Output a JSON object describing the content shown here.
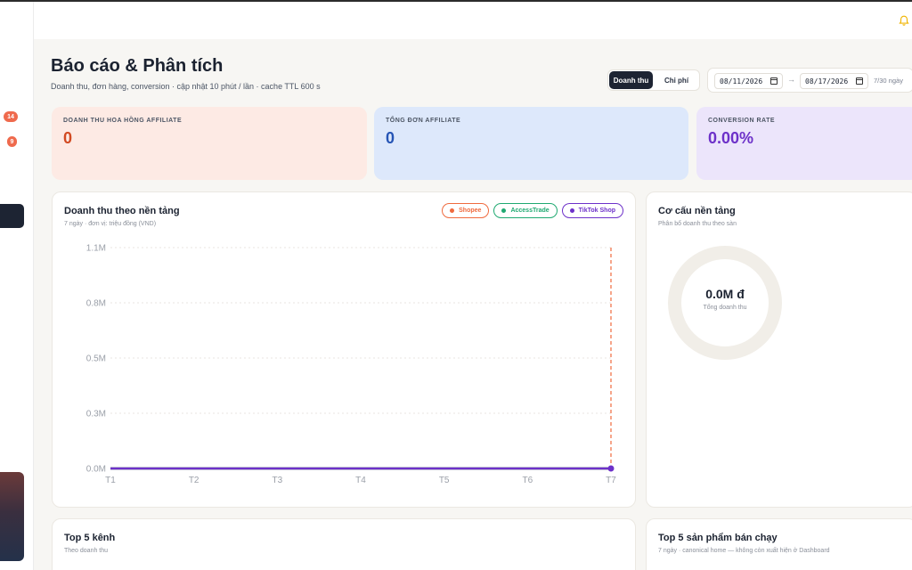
{
  "sidebar": {
    "badges": [
      "14",
      "9"
    ]
  },
  "header": {
    "title": "Báo cáo & Phân tích",
    "subtitle": "Doanh thu, đơn hàng, conversion · cập nhật 10 phút / lần · cache TTL 600 s"
  },
  "toolbar": {
    "tabs": [
      {
        "label": "Doanh thu",
        "active": true
      },
      {
        "label": "Chi phí",
        "active": false
      }
    ],
    "date_from": "08/11/2026",
    "date_sep": "→",
    "date_to": "08/17/2026",
    "range": "7/30 ngày"
  },
  "kpis": [
    {
      "label": "DOANH THU HOA HỒNG AFFILIATE",
      "value": "0"
    },
    {
      "label": "TỔNG ĐƠN AFFILIATE",
      "value": "0"
    },
    {
      "label": "CONVERSION RATE",
      "value": "0.00%"
    }
  ],
  "revenue_card": {
    "title": "Doanh thu theo nền tảng",
    "subtitle": "7 ngày · đơn vị: triệu đồng (VND)",
    "legend": [
      {
        "label": "Shopee",
        "color": "#ef6a3e"
      },
      {
        "label": "AccessTrade",
        "color": "#1fa971"
      },
      {
        "label": "TikTok Shop",
        "color": "#6d31c9"
      }
    ]
  },
  "chart_data": {
    "type": "line",
    "categories": [
      "T1",
      "T2",
      "T3",
      "T4",
      "T5",
      "T6",
      "T7"
    ],
    "y_ticks": [
      "0.0M",
      "0.3M",
      "0.5M",
      "0.8M",
      "1.1M"
    ],
    "ylim": [
      0,
      1.1
    ],
    "grid": true,
    "series": [
      {
        "name": "Shopee",
        "color": "#ef6a3e",
        "values": [
          0,
          0,
          0,
          0,
          0,
          0,
          0
        ]
      },
      {
        "name": "AccessTrade",
        "color": "#1fa971",
        "values": [
          0,
          0,
          0,
          0,
          0,
          0,
          0
        ]
      },
      {
        "name": "TikTok Shop",
        "color": "#6d31c9",
        "values": [
          0,
          0,
          0,
          0,
          0,
          0,
          0
        ]
      }
    ],
    "highlight_category": "T7"
  },
  "platform_card": {
    "title": "Cơ cấu nền tảng",
    "subtitle": "Phân bổ doanh thu theo sàn",
    "total_value": "0.0M đ",
    "total_label": "Tổng doanh thu"
  },
  "top_channels": {
    "title": "Top 5 kênh",
    "subtitle": "Theo doanh thu"
  },
  "top_products": {
    "title": "Top 5 sản phẩm bán chạy",
    "subtitle": "7 ngày · canonical home — không còn xuất hiện ở Dashboard"
  },
  "icons": {
    "notifications": "bell-icon",
    "calendar": "calendar-icon"
  }
}
